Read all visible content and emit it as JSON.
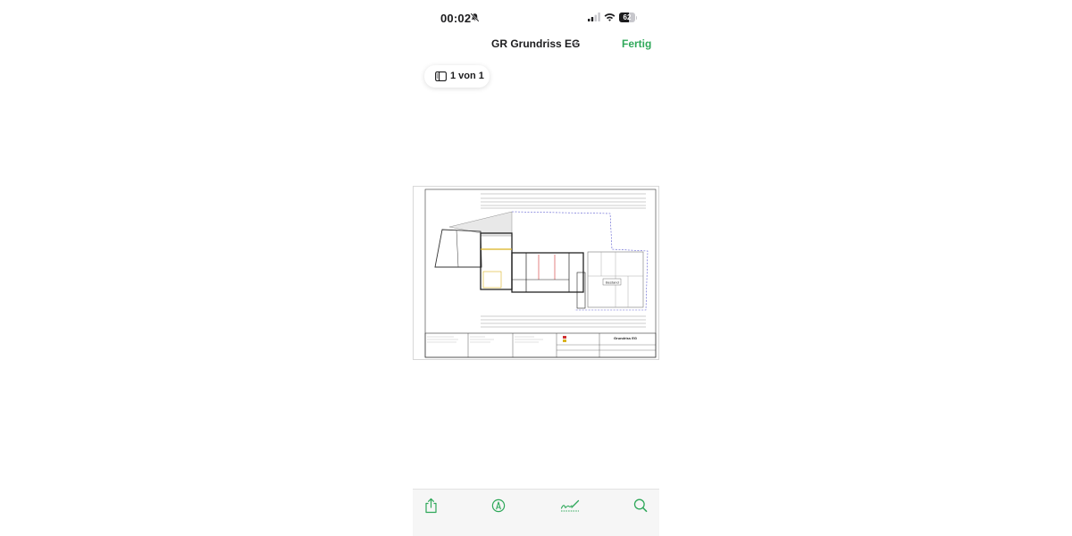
{
  "status_bar": {
    "time": "00:02",
    "battery_level": "62",
    "battery_fraction": 0.62,
    "icons": [
      "bell-slash-icon",
      "cellular-signal-icon",
      "wifi-icon",
      "battery-icon"
    ]
  },
  "nav": {
    "title": "GR Grundriss EG",
    "done_label": "Fertig",
    "title_menu_icon": "chevron-down-icon"
  },
  "page_indicator": {
    "label": "1 von 1",
    "icon": "sidebar-icon"
  },
  "document": {
    "sheet_title": "Grundriss EG",
    "room_label": "Bestand"
  },
  "toolbar": {
    "items": [
      "share-icon",
      "markup-icon",
      "signature-icon",
      "search-icon"
    ]
  },
  "colors": {
    "accent": "#2fa85a",
    "text": "#1c1c1e",
    "toolbar_icon": "#2fa85a",
    "plan_blue": "#5a5ad0",
    "plan_yellow": "#d9b21f",
    "plan_red": "#d03030"
  }
}
